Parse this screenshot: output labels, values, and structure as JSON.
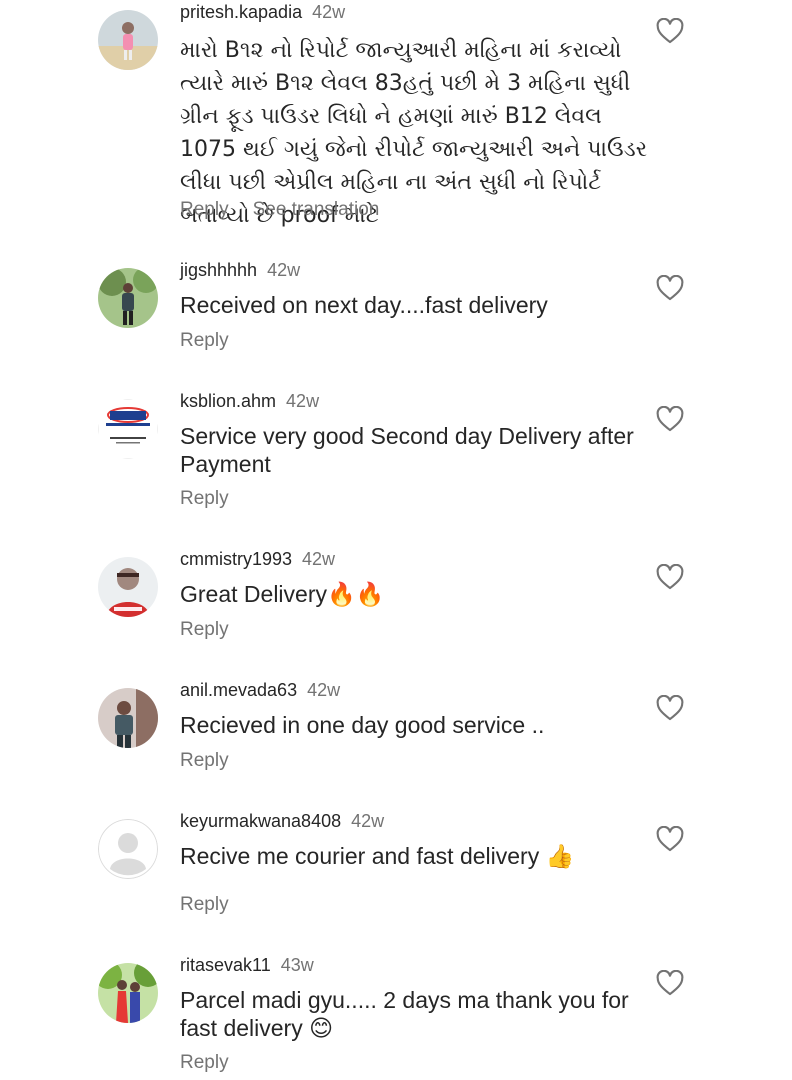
{
  "colors": {
    "text": "#262626",
    "secondary": "#737373",
    "background": "#ffffff"
  },
  "icons": {
    "like": "heart-outline-icon"
  },
  "comments": [
    {
      "username": "pritesh.kapadia",
      "time": "42w",
      "text": "મારો B૧૨ નો રિપોર્ટ જાન્યુઆરી મહિના માં કરાવ્યો ત્યારે મારું B૧૨ લેવલ 83હતું પછી મે 3 મહિના સુધી ગ્રીન ફૂડ પાઉડર લિધો ને હમણાં મારું B12 લેવલ 1075 થઈ ગયું જેનો રીપોર્ટ જાન્યુઆરી અને પાઉડર લીધા પછી એપ્રીલ મહિના ના અંત સુધી નો રિપોર્ટ બતાવ્યો છે proof માટે",
      "reply": "Reply",
      "translation": "See translation"
    },
    {
      "username": "jigshhhhh",
      "time": "42w",
      "text": "Received on next day....fast delivery",
      "reply": "Reply"
    },
    {
      "username": "ksblion.ahm",
      "time": "42w",
      "text": "Service very good Second day Delivery after Payment",
      "reply": "Reply"
    },
    {
      "username": "cmmistry1993",
      "time": "42w",
      "text": "Great Delivery🔥🔥",
      "reply": "Reply"
    },
    {
      "username": "anil.mevada63",
      "time": "42w",
      "text": "Recieved in one day good service ..",
      "reply": "Reply"
    },
    {
      "username": "keyurmakwana8408",
      "time": "42w",
      "text": "Recive me courier and fast delivery 👍",
      "reply": "Reply"
    },
    {
      "username": "ritasevak11",
      "time": "43w",
      "text": "Parcel madi gyu..... 2 days ma thank you for fast delivery 😊",
      "reply": "Reply"
    }
  ]
}
